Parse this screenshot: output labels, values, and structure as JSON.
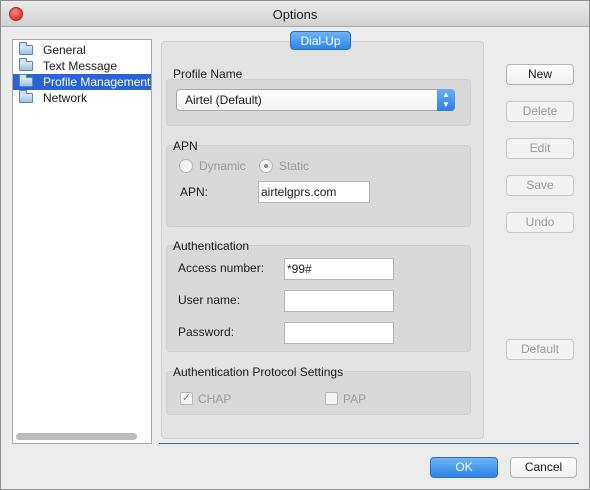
{
  "window": {
    "title": "Options"
  },
  "sidebar": {
    "items": [
      {
        "label": "General",
        "selected": false
      },
      {
        "label": "Text Message",
        "selected": false
      },
      {
        "label": "Profile Management",
        "selected": true
      },
      {
        "label": "Network",
        "selected": false
      }
    ]
  },
  "tab": {
    "label": "Dial-Up"
  },
  "profile": {
    "group_label": "Profile Name",
    "selected": "Airtel (Default)"
  },
  "apn": {
    "group_label": "APN",
    "dynamic_label": "Dynamic",
    "static_label": "Static",
    "selected": "Static",
    "field_label": "APN:",
    "value": "airtelgprs.com"
  },
  "auth": {
    "group_label": "Authentication",
    "access_label": "Access number:",
    "access_value": "*99#",
    "user_label": "User name:",
    "user_value": "",
    "password_label": "Password:",
    "password_value": ""
  },
  "protocol": {
    "group_label": "Authentication Protocol Settings",
    "chap_label": "CHAP",
    "chap_checked": true,
    "pap_label": "PAP",
    "pap_checked": false
  },
  "actions": {
    "new": "New",
    "delete": "Delete",
    "edit": "Edit",
    "save": "Save",
    "undo": "Undo",
    "default": "Default"
  },
  "footer": {
    "ok": "OK",
    "cancel": "Cancel"
  },
  "colors": {
    "accent": "#2a82e6",
    "selection": "#2a63d8"
  }
}
